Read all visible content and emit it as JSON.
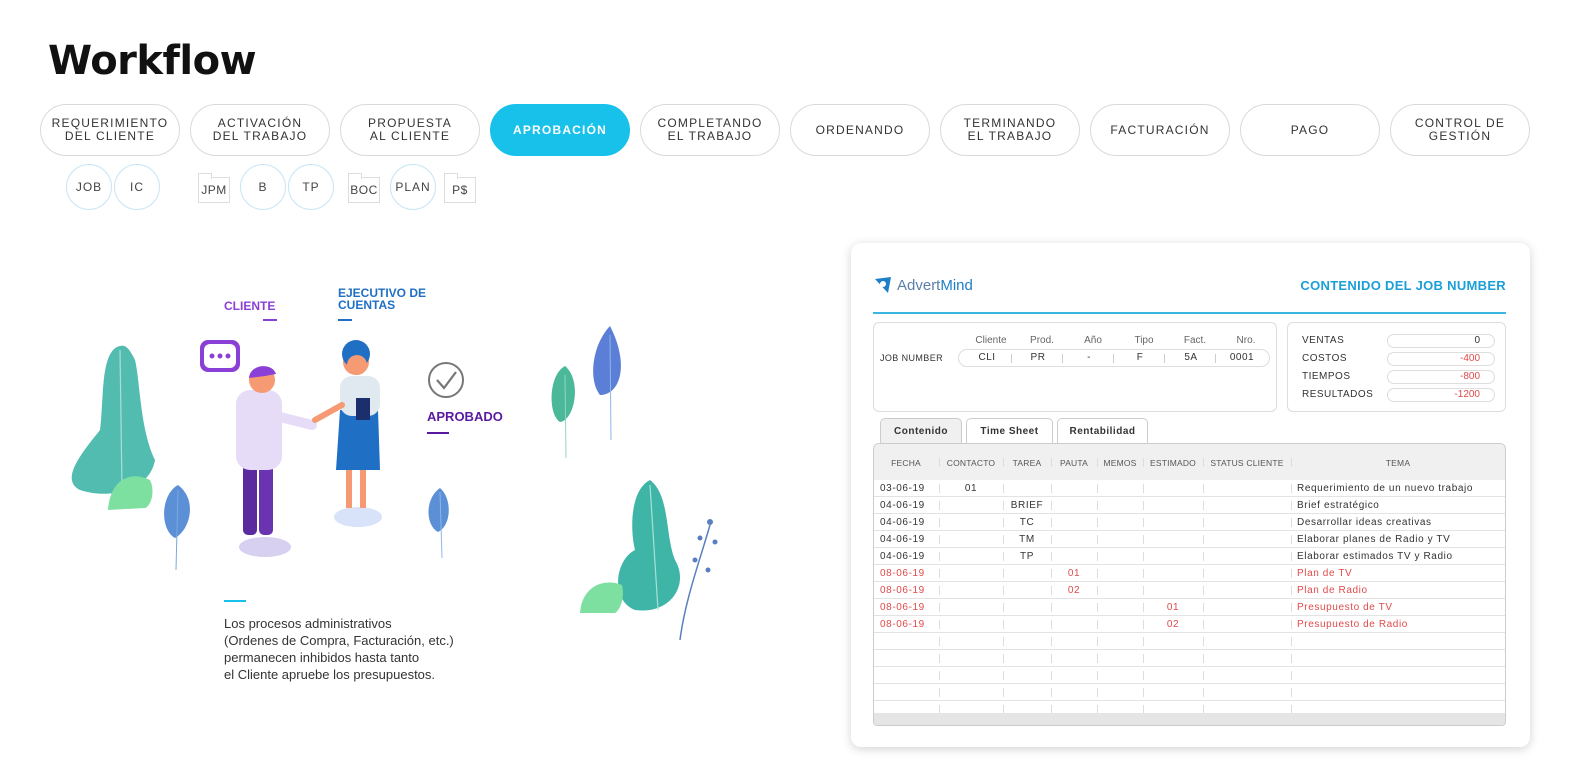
{
  "page_title": "Workflow",
  "steps": [
    {
      "label": "REQUERIMIENTO\nDEL CLIENTE",
      "active": false
    },
    {
      "label": "ACTIVACIÓN\nDEL TRABAJO",
      "active": false
    },
    {
      "label": "PROPUESTA\nAL CLIENTE",
      "active": false
    },
    {
      "label": "APROBACIÓN",
      "active": true
    },
    {
      "label": "COMPLETANDO\nEL TRABAJO",
      "active": false
    },
    {
      "label": "ORDENANDO",
      "active": false
    },
    {
      "label": "TERMINANDO\nEL TRABAJO",
      "active": false
    },
    {
      "label": "FACTURACIÓN",
      "active": false
    },
    {
      "label": "PAGO",
      "active": false
    },
    {
      "label": "CONTROL DE\nGESTIÓN",
      "active": false
    }
  ],
  "sub_items": {
    "job": "JOB",
    "ic": "IC",
    "jpm": "JPM",
    "b": "B",
    "tp": "TP",
    "boc": "BOC",
    "plan": "PLAN",
    "ps": "P$"
  },
  "illustration": {
    "cliente": "CLIENTE",
    "ejecutivo": "EJECUTIVO DE\nCUENTAS",
    "aprobado": "APROBADO",
    "description": "Los procesos administrativos\n(Ordenes de Compra, Facturación, etc.)\npermanecen inhibidos hasta tanto\nel Cliente apruebe los presupuestos."
  },
  "card": {
    "logo_prefix": "Advert",
    "logo_suffix": "Mind",
    "title": "CONTENIDO DEL JOB NUMBER",
    "job_number_label": "JOB NUMBER",
    "job_headers": [
      "Cliente",
      "Prod.",
      "Año",
      "Tipo",
      "Fact.",
      "Nro."
    ],
    "job_values": [
      "CLI",
      "PR",
      "-",
      "F",
      "5A",
      "0001"
    ],
    "totals": [
      {
        "label": "VENTAS",
        "value": "0",
        "color": "#333333"
      },
      {
        "label": "COSTOS",
        "value": "-400",
        "color": "#e04a4a"
      },
      {
        "label": "TIEMPOS",
        "value": "-800",
        "color": "#e04a4a"
      },
      {
        "label": "RESULTADOS",
        "value": "-1200",
        "color": "#e04a4a"
      }
    ],
    "tabs": [
      "Contenido",
      "Time Sheet",
      "Rentabilidad"
    ],
    "table_headers": [
      "FECHA",
      "CONTACTO",
      "TAREA",
      "PAUTA",
      "MEMOS",
      "ESTIMADO",
      "STATUS CLIENTE",
      "TEMA"
    ],
    "rows": [
      {
        "fecha": "03-06-19",
        "contacto": "01",
        "tarea": "",
        "pauta": "",
        "memos": "",
        "estimado": "",
        "status": "",
        "tema": "Requerimiento de un nuevo trabajo",
        "red": false
      },
      {
        "fecha": "04-06-19",
        "contacto": "",
        "tarea": "BRIEF",
        "pauta": "",
        "memos": "",
        "estimado": "",
        "status": "",
        "tema": "Brief estratégico",
        "red": false
      },
      {
        "fecha": "04-06-19",
        "contacto": "",
        "tarea": "TC",
        "pauta": "",
        "memos": "",
        "estimado": "",
        "status": "",
        "tema": "Desarrollar ideas creativas",
        "red": false
      },
      {
        "fecha": "04-06-19",
        "contacto": "",
        "tarea": "TM",
        "pauta": "",
        "memos": "",
        "estimado": "",
        "status": "",
        "tema": "Elaborar planes de Radio y TV",
        "red": false
      },
      {
        "fecha": "04-06-19",
        "contacto": "",
        "tarea": "TP",
        "pauta": "",
        "memos": "",
        "estimado": "",
        "status": "",
        "tema": "Elaborar estimados TV y Radio",
        "red": false
      },
      {
        "fecha": "08-06-19",
        "contacto": "",
        "tarea": "",
        "pauta": "01",
        "memos": "",
        "estimado": "",
        "status": "",
        "tema": "Plan de TV",
        "red": true
      },
      {
        "fecha": "08-06-19",
        "contacto": "",
        "tarea": "",
        "pauta": "02",
        "memos": "",
        "estimado": "",
        "status": "",
        "tema": "Plan de Radio",
        "red": true
      },
      {
        "fecha": "08-06-19",
        "contacto": "",
        "tarea": "",
        "pauta": "",
        "memos": "",
        "estimado": "01",
        "status": "",
        "tema": "Presupuesto de TV",
        "red": true
      },
      {
        "fecha": "08-06-19",
        "contacto": "",
        "tarea": "",
        "pauta": "",
        "memos": "",
        "estimado": "02",
        "status": "",
        "tema": "Presupuesto de Radio",
        "red": true
      },
      {
        "fecha": "",
        "contacto": "",
        "tarea": "",
        "pauta": "",
        "memos": "",
        "estimado": "",
        "status": "",
        "tema": "",
        "red": false
      },
      {
        "fecha": "",
        "contacto": "",
        "tarea": "",
        "pauta": "",
        "memos": "",
        "estimado": "",
        "status": "",
        "tema": "",
        "red": false
      },
      {
        "fecha": "",
        "contacto": "",
        "tarea": "",
        "pauta": "",
        "memos": "",
        "estimado": "",
        "status": "",
        "tema": "",
        "red": false
      },
      {
        "fecha": "",
        "contacto": "",
        "tarea": "",
        "pauta": "",
        "memos": "",
        "estimado": "",
        "status": "",
        "tema": "",
        "red": false
      },
      {
        "fecha": "",
        "contacto": "",
        "tarea": "",
        "pauta": "",
        "memos": "",
        "estimado": "",
        "status": "",
        "tema": "",
        "red": false
      }
    ]
  },
  "colors": {
    "accent": "#18c1ea",
    "cliente": "#8a3fd6",
    "ejecutivo": "#1f6fc4",
    "aprobado": "#5a1aa0",
    "negative": "#e04a4a"
  }
}
